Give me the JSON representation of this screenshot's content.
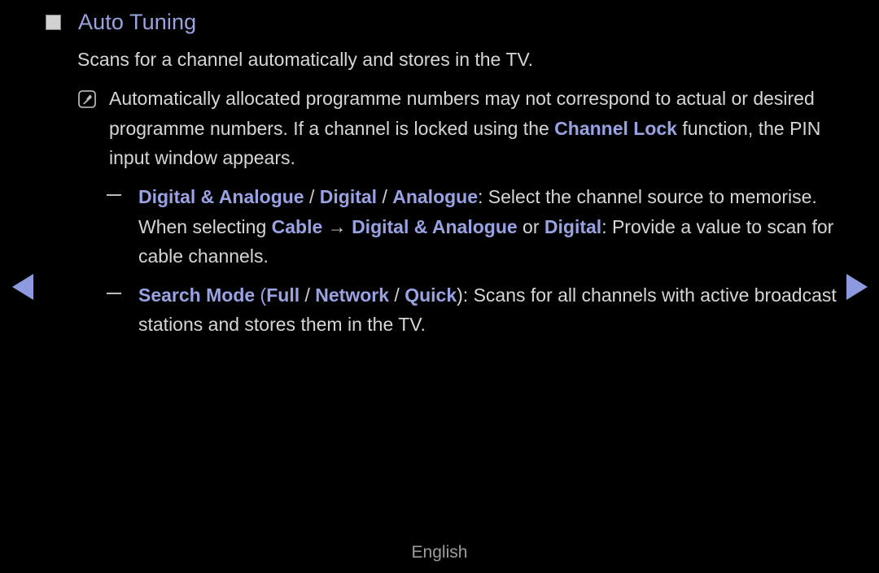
{
  "colors": {
    "background": "#000000",
    "body_text": "#d6d6d6",
    "accent_blue": "#99a2e2",
    "heading_blue": "#9aa3e0",
    "arrow_blue": "#8e9ae0",
    "bullet_square": "#d0d2d0",
    "footer_text": "#9d9d9d"
  },
  "heading": {
    "bullet_icon": "square-bullet-icon",
    "title": "Auto Tuning"
  },
  "intro": {
    "text": "Scans for a channel automatically and stores in the TV."
  },
  "note": {
    "icon": "note-pen-icon",
    "part1": "Automatically allocated programme numbers may not correspond to actual or desired programme numbers. If a channel is locked using the ",
    "term_channel_lock": "Channel Lock",
    "part2": " function, the PIN input window appears."
  },
  "dash_items": [
    {
      "mark": "dash-bullet-icon",
      "term_1": "Digital & Analogue",
      "sep_1": " / ",
      "term_2": "Digital",
      "sep_2": " / ",
      "term_3": "Analogue",
      "text_1": ": Select the channel source to memorise. When selecting ",
      "term_4": "Cable",
      "arrow": " → ",
      "term_5": "Digital & Analogue",
      "text_2": " or ",
      "term_6": "Digital",
      "text_3": ": Provide a value to scan for cable channels."
    },
    {
      "mark": "dash-bullet-icon",
      "term_1": "Search Mode",
      "paren_open": " (",
      "term_2": "Full",
      "sep_1": " / ",
      "term_3": "Network",
      "sep_2": " / ",
      "term_4": "Quick",
      "paren_close": ")",
      "text_1": ": Scans for all channels with active broadcast stations and stores them in the TV."
    }
  ],
  "navigation": {
    "prev_icon": "arrow-left-icon",
    "next_icon": "arrow-right-icon"
  },
  "footer": {
    "language": "English"
  }
}
